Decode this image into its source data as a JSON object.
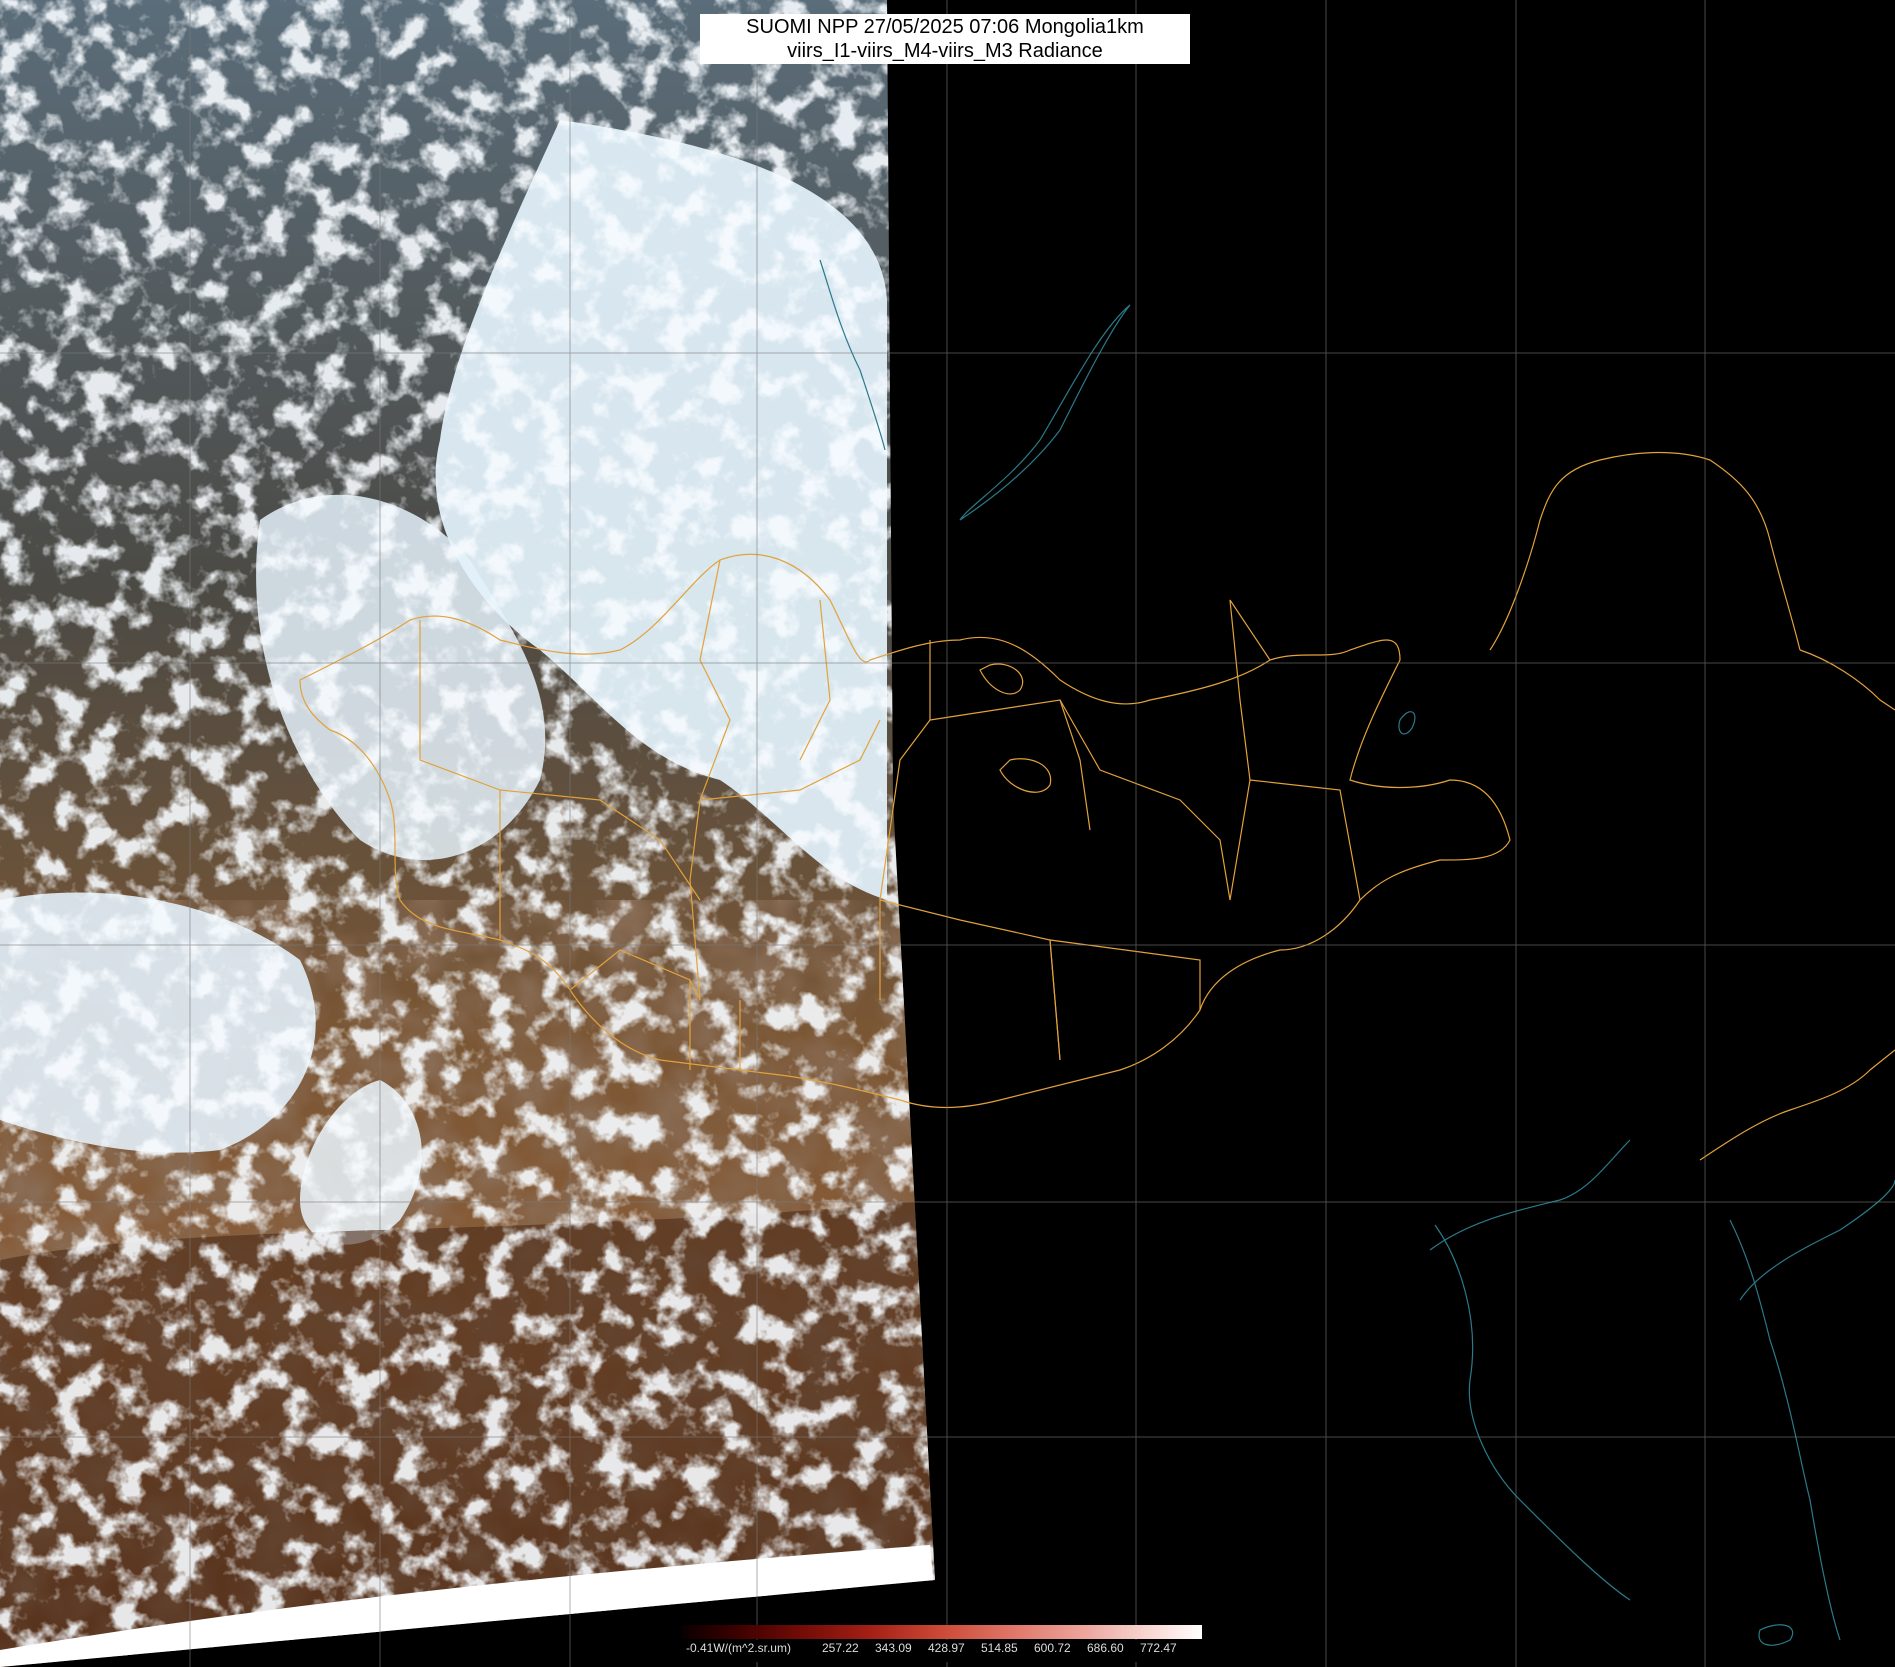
{
  "title": {
    "line1": "SUOMI NPP 27/05/2025 07:06 Mongolia1km",
    "line2": "viirs_I1-viirs_M4-viirs_M3 Radiance"
  },
  "colorbar": {
    "ticks": [
      "-0.41W/(m^2.sr.um)",
      "257.22",
      "343.09",
      "428.97",
      "514.85",
      "600.72",
      "686.60",
      "772.47"
    ],
    "colors": [
      "#0a0000",
      "#6e0b06",
      "#cc4a36",
      "#ffffff"
    ]
  },
  "colors": {
    "border_lines": "#e2a23c",
    "coastline": "#2a7a8a",
    "grid": "#7a7a7a",
    "background": "#000000"
  }
}
